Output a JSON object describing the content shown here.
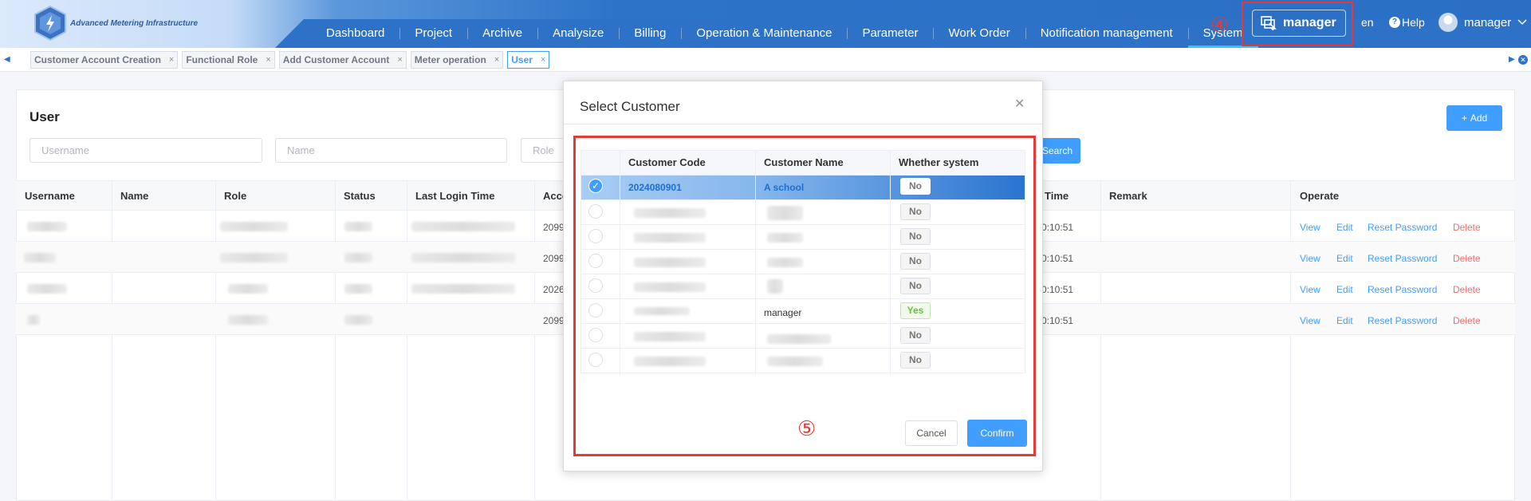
{
  "header": {
    "logo_text": "Advanced Metering Infrastructure",
    "nav": [
      "Dashboard",
      "Project",
      "Archive",
      "Analysize",
      "Billing",
      "Operation & Maintenance",
      "Parameter",
      "Work Order",
      "Notification management",
      "System"
    ],
    "active_nav": "System",
    "step_marker_4": "④",
    "role_switch_label": "manager",
    "language": "en",
    "help_label": "Help",
    "user_name": "manager"
  },
  "tabs": [
    "Customer Account Creation",
    "Functional Role",
    "Add Customer Account",
    "Meter operation",
    "User"
  ],
  "active_tab": "User",
  "page": {
    "title": "User",
    "add_label": "Add",
    "filters": {
      "username_placeholder": "Username",
      "name_placeholder": "Name",
      "role_placeholder": "Role"
    },
    "search_label": "Search",
    "columns": [
      "Username",
      "Name",
      "Role",
      "Status",
      "Last Login Time",
      "Acco",
      "Time",
      "Remark",
      "Operate"
    ],
    "rows": [
      {
        "account_prefix": "2099",
        "time_suffix": "0:10:51"
      },
      {
        "account_prefix": "2099",
        "time_suffix": "0:10:51"
      },
      {
        "account_prefix": "2026",
        "time_suffix": "0:10:51"
      },
      {
        "account_prefix": "2099",
        "time_suffix": "0:10:51"
      }
    ],
    "operations": {
      "view": "View",
      "edit": "Edit",
      "reset": "Reset Password",
      "delete": "Delete"
    }
  },
  "modal": {
    "title": "Select Customer",
    "columns": [
      "Customer Code",
      "Customer Name",
      "Whether system"
    ],
    "rows": [
      {
        "code": "2024080901",
        "name": "A school",
        "system": "No",
        "selected": true
      },
      {
        "code": "",
        "name": "",
        "system": "No",
        "selected": false
      },
      {
        "code": "",
        "name": "",
        "system": "No",
        "selected": false
      },
      {
        "code": "",
        "name": "",
        "system": "No",
        "selected": false
      },
      {
        "code": "",
        "name": "",
        "system": "No",
        "selected": false
      },
      {
        "code": "",
        "name": "manager",
        "system": "Yes",
        "selected": false
      },
      {
        "code": "",
        "name": "",
        "system": "No",
        "selected": false
      },
      {
        "code": "",
        "name": "",
        "system": "No",
        "selected": false
      }
    ],
    "step_marker_5": "⑤",
    "cancel_label": "Cancel",
    "confirm_label": "Confirm"
  },
  "colors": {
    "primary": "#409eff",
    "header_blue": "#2d72c7",
    "highlight_red": "#e53935",
    "delete_red": "#f56c6c",
    "success_green": "#67c23a"
  }
}
